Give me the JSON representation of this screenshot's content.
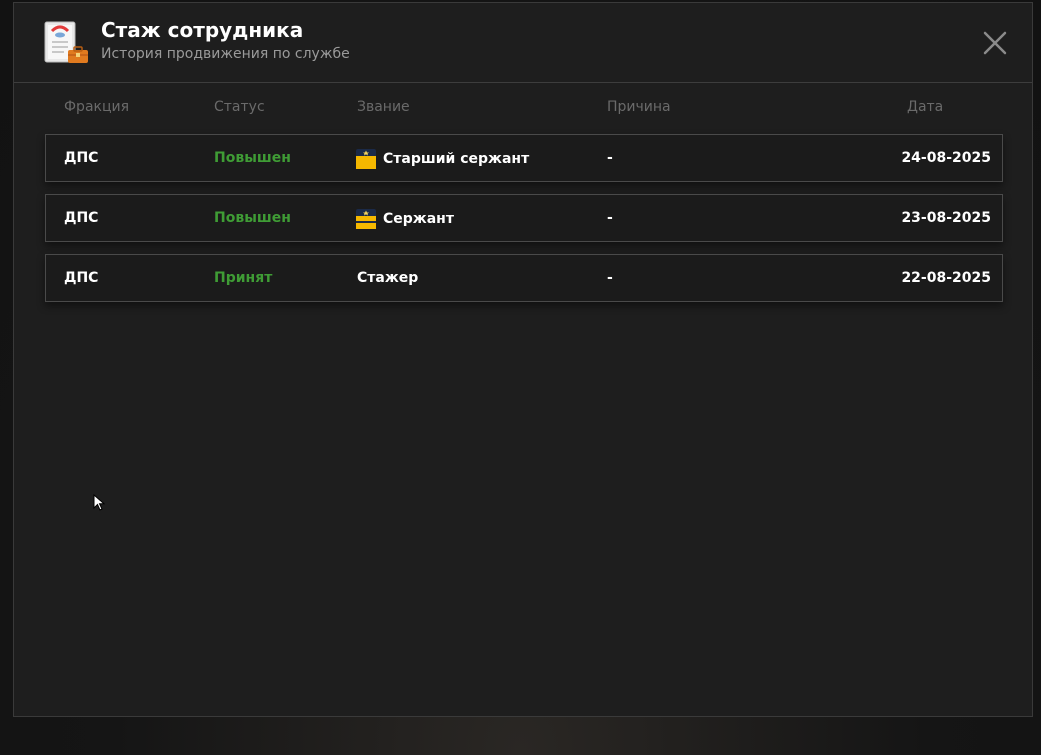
{
  "header": {
    "title": "Стаж сотрудника",
    "subtitle": "История продвижения по службе",
    "icon": "document-briefcase-icon",
    "close_icon": "close-icon"
  },
  "columns": {
    "faction": "Фракция",
    "status": "Статус",
    "rank": "Звание",
    "reason": "Причина",
    "date": "Дата"
  },
  "rows": [
    {
      "faction": "ДПС",
      "status": "Повышен",
      "rank": "Старший сержант",
      "rank_icon": "senior-sergeant-epaulette-icon",
      "reason": "-",
      "date": "24-08-2025"
    },
    {
      "faction": "ДПС",
      "status": "Повышен",
      "rank": "Сержант",
      "rank_icon": "sergeant-epaulette-icon",
      "reason": "-",
      "date": "23-08-2025"
    },
    {
      "faction": "ДПС",
      "status": "Принят",
      "rank": "Стажер",
      "rank_icon": "",
      "reason": "-",
      "date": "22-08-2025"
    }
  ],
  "colors": {
    "status_green": "#3f9c35",
    "epaulette_yellow": "#f5b800",
    "epaulette_navy": "#1b2a48"
  }
}
